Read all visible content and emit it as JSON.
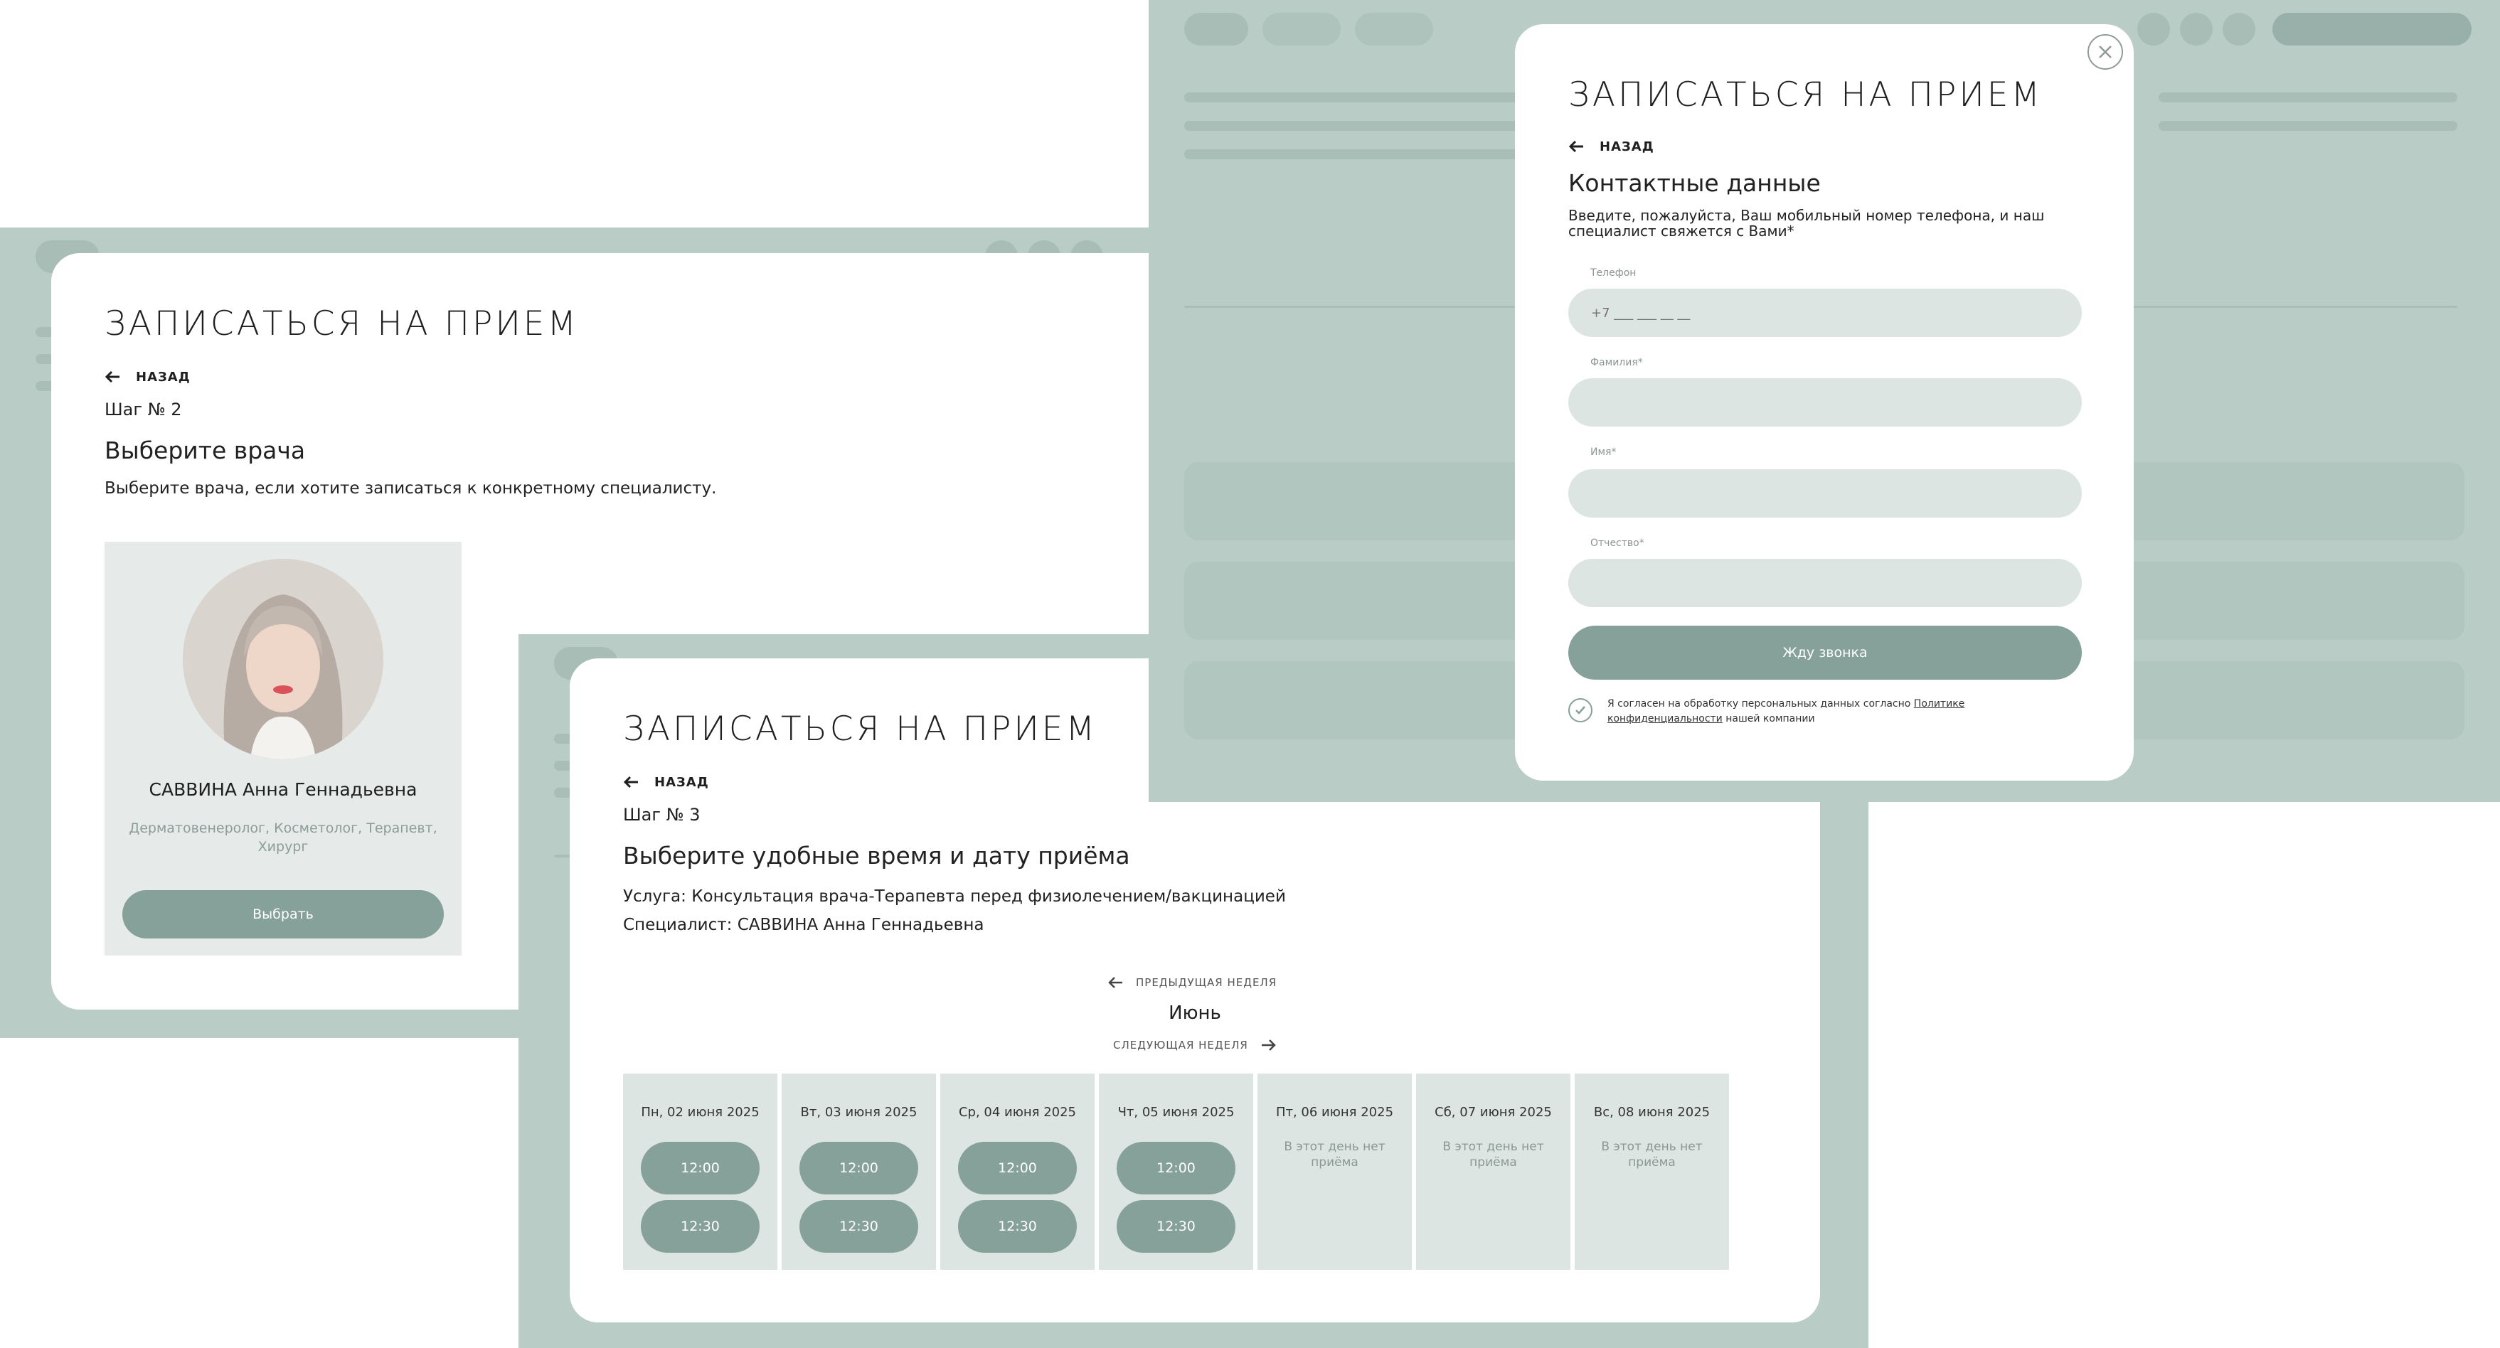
{
  "left": {
    "title": "ЗАПИСАТЬСЯ НА ПРИЕМ",
    "back": "НАЗАД",
    "step": "Шаг № 2",
    "heading": "Выберите врача",
    "description": "Выберите врача, если хотите записаться к конкретному специалисту.",
    "doctor": {
      "name": "САВВИНА Анна Геннадьевна",
      "specialties": "Дерматовенеролог, Косметолог, Терапевт, Хирург",
      "select_label": "Выбрать"
    }
  },
  "middle": {
    "title": "ЗАПИСАТЬСЯ НА ПРИЕМ",
    "back": "НАЗАД",
    "step": "Шаг № 3",
    "heading": "Выберите удобные время и дату приёма",
    "service": "Услуга: Консультация врача-Терапевта перед физиолечением/вакцинацией",
    "specialist": "Специалист: САВВИНА Анна Геннадьевна",
    "prev_week": "ПРЕДЫДУЩАЯ НЕДЕЛЯ",
    "month": "Июнь",
    "next_week": "СЛЕДУЮЩАЯ НЕДЕЛЯ",
    "days": [
      {
        "date": "Пн, 02 июня 2025",
        "slots": [
          "12:00",
          "12:30"
        ]
      },
      {
        "date": "Вт, 03 июня 2025",
        "slots": [
          "12:00",
          "12:30"
        ]
      },
      {
        "date": "Ср, 04 июня 2025",
        "slots": [
          "12:00",
          "12:30"
        ]
      },
      {
        "date": "Чт, 05 июня 2025",
        "slots": [
          "12:00",
          "12:30"
        ]
      },
      {
        "date": "Пт, 06 июня 2025",
        "none": "В этот день нет приёма"
      },
      {
        "date": "Сб, 07 июня 2025",
        "none": "В этот день нет приёма"
      },
      {
        "date": "Вс, 08 июня 2025",
        "none": "В этот день нет приёма"
      }
    ]
  },
  "right": {
    "title": "ЗАПИСАТЬСЯ НА ПРИЕМ",
    "back": "НАЗАД",
    "heading": "Контактные данные",
    "description": "Введите, пожалуйста, Ваш мобильный номер телефона, и наш специалист свяжется с Вами*",
    "phone_label": "Телефон",
    "phone_placeholder": "+7 ___ ___ __ __",
    "lastname_label": "Фамилия*",
    "firstname_label": "Имя*",
    "patronymic_label": "Отчество*",
    "submit_label": "Жду звонка",
    "consent_text": "Я согласен на обработку персональных данных согласно",
    "consent_link": "Политике конфиденциальности",
    "consent_tail": "нашей компании"
  },
  "colors": {
    "accent": "#86a09a",
    "backdrop": "#b9ccc6",
    "field": "#dce5e2",
    "card": "#e6ebea"
  }
}
